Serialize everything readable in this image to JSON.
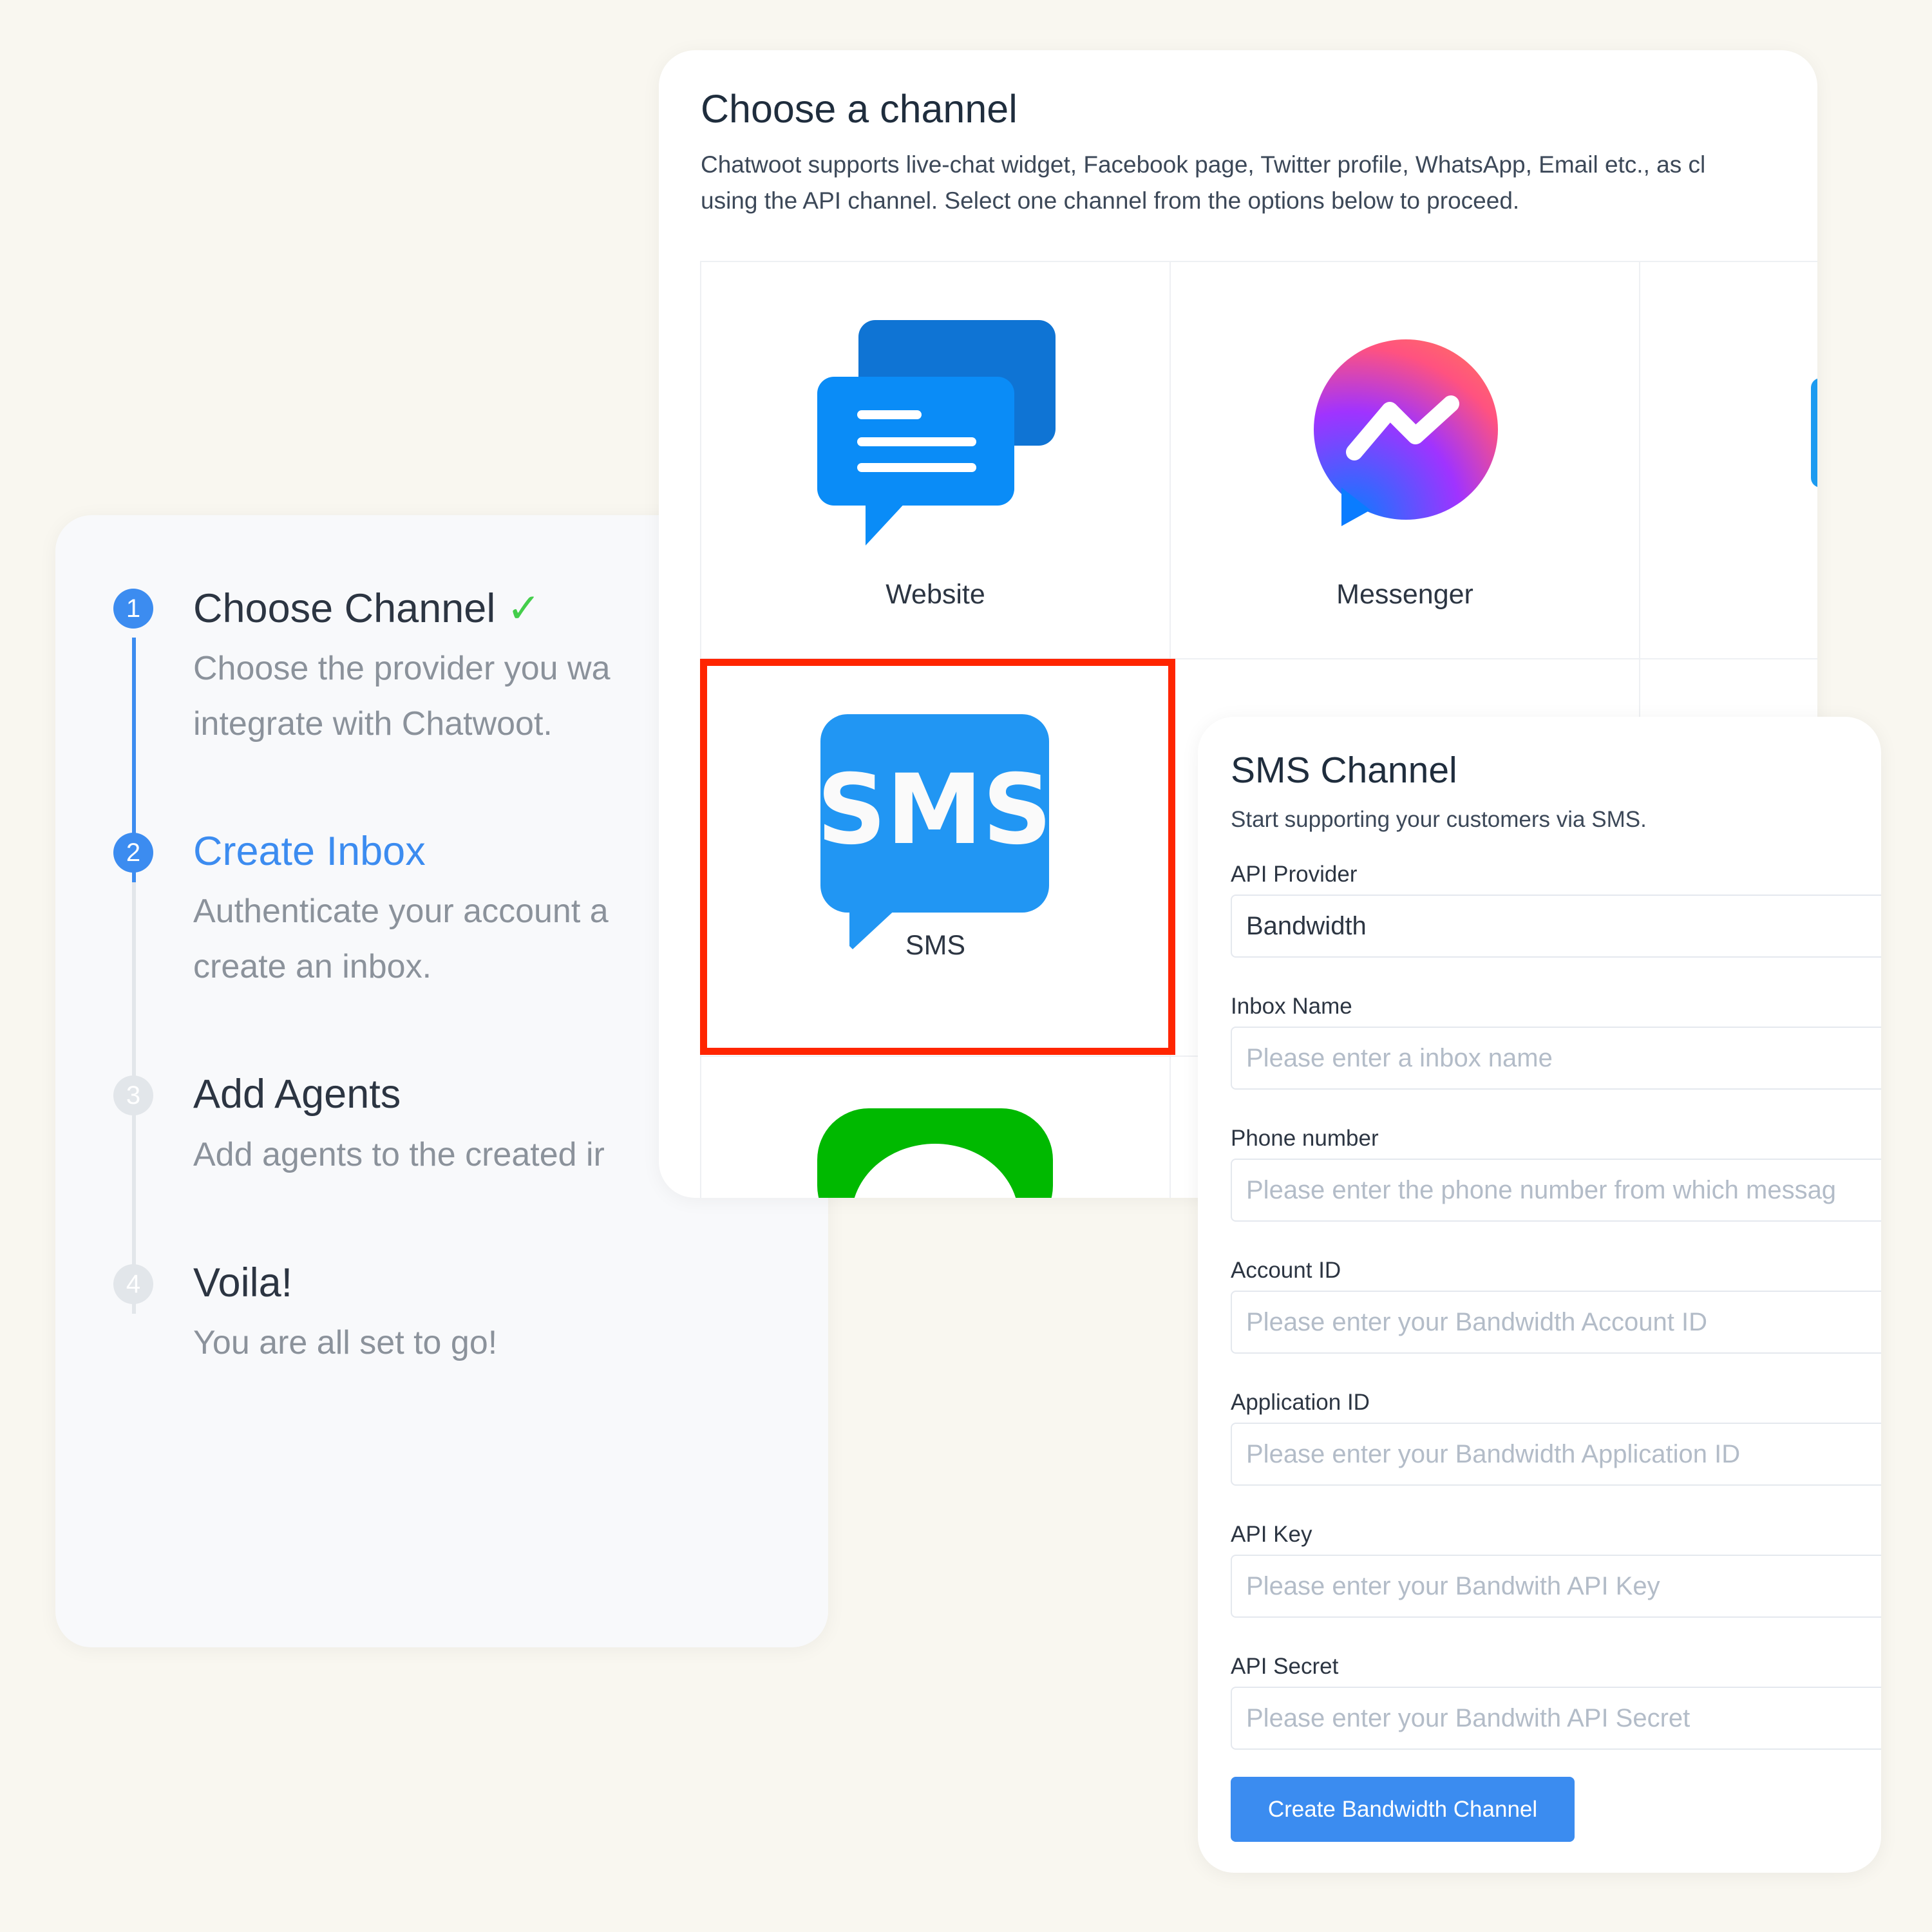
{
  "steps": [
    {
      "num": "1",
      "title": "Choose Channel",
      "desc": "Choose the provider you want to integrate with Chatwoot.",
      "line1": "Choose the provider you wa",
      "line2": "integrate with Chatwoot.",
      "status": "complete"
    },
    {
      "num": "2",
      "title": "Create Inbox",
      "line1": "Authenticate your account a",
      "line2": "create an inbox.",
      "status": "active"
    },
    {
      "num": "3",
      "title": "Add Agents",
      "line1": "Add agents to the created ir",
      "status": "pending"
    },
    {
      "num": "4",
      "title": "Voila!",
      "line1": "You are all set to go!",
      "status": "pending"
    }
  ],
  "channels": {
    "title": "Choose a channel",
    "desc1": "Chatwoot supports live-chat widget, Facebook page, Twitter profile, WhatsApp, Email etc., as cl",
    "desc2": "using the API channel. Select one channel from the options below to proceed.",
    "items": [
      {
        "label": "Website",
        "icon": "website-chat-icon"
      },
      {
        "label": "Messenger",
        "icon": "messenger-icon"
      },
      {
        "label": "SMS",
        "icon": "sms-icon",
        "selected": true
      }
    ]
  },
  "form": {
    "title": "SMS Channel",
    "subtitle": "Start supporting your customers via SMS.",
    "fields": [
      {
        "label": "API Provider",
        "value": "Bandwidth",
        "placeholder": ""
      },
      {
        "label": "Inbox Name",
        "value": "",
        "placeholder": "Please enter a inbox name"
      },
      {
        "label": "Phone number",
        "value": "",
        "placeholder": "Please enter the phone number from which messag"
      },
      {
        "label": "Account ID",
        "value": "",
        "placeholder": "Please enter your Bandwidth Account ID"
      },
      {
        "label": "Application ID",
        "value": "",
        "placeholder": "Please enter your Bandwidth Application ID"
      },
      {
        "label": "API Key",
        "value": "",
        "placeholder": "Please enter your Bandwith API Key"
      },
      {
        "label": "API Secret",
        "value": "",
        "placeholder": "Please enter your Bandwith API Secret"
      }
    ],
    "submit": "Create Bandwidth Channel"
  },
  "colors": {
    "accent": "#3b8cf0",
    "selection": "#ff2500",
    "check": "#44ce4b"
  }
}
